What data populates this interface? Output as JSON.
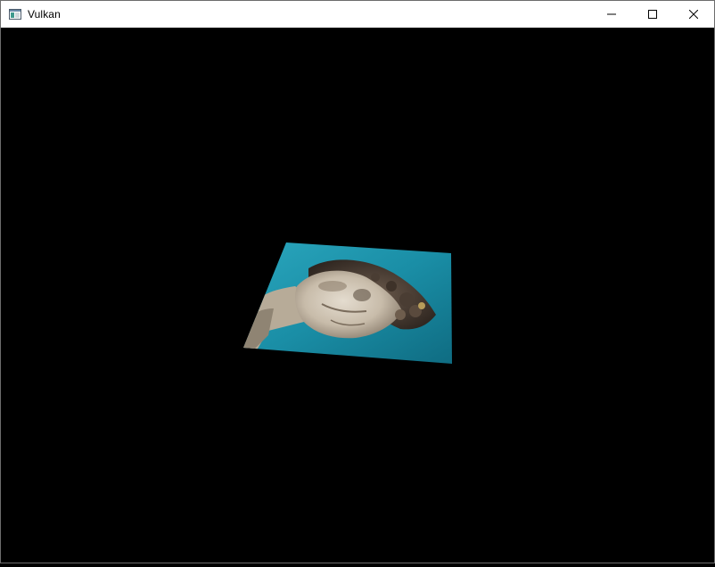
{
  "window": {
    "title": "Vulkan",
    "background_color": "#000000",
    "controls": [
      "minimize-icon",
      "maximize-icon",
      "close-icon"
    ]
  },
  "scene": {
    "object": "textured-quad",
    "texture_subject": "statue-head",
    "sky_color": "#1b90a8"
  }
}
